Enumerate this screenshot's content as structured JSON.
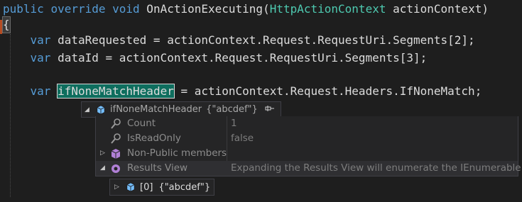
{
  "code": {
    "l1": {
      "kw1": "public",
      "kw2": "override",
      "kw3": "void",
      "method": " OnActionExecuting(",
      "type": "HttpActionContext",
      "rest": " actionContext)"
    },
    "l2": {
      "brace": "{"
    },
    "l3": {
      "kw": "var",
      "rest": " dataRequested = actionContext.Request.RequestUri.Segments[2];"
    },
    "l4": {
      "kw": "var",
      "rest": " dataId = actionContext.Request.RequestUri.Segments[3];"
    },
    "l5": {
      "kw": "var",
      "selected": "ifNoneMatchHeader",
      "rest": " = actionContext.Request.Headers.IfNoneMatch;"
    }
  },
  "datatip": {
    "name": "ifNoneMatchHeader",
    "value": "{\"abcdef\"}",
    "rows": [
      {
        "name": "Count",
        "value": "1"
      },
      {
        "name": "IsReadOnly",
        "value": "false"
      },
      {
        "name": "Non-Public members",
        "value": ""
      },
      {
        "name": "Results View",
        "value": "Expanding the Results View will enumerate the IEnumerable"
      }
    ],
    "child": {
      "index": "[0]",
      "value": "{\"abcdef\"}"
    }
  },
  "icons": {
    "object": "object-icon",
    "property": "property-wrench-icon",
    "non_public": "non-public-members-icon",
    "results": "results-view-icon",
    "pin": "pin-icon"
  },
  "colors": {
    "background": "#1e1e1e",
    "keyword": "#569cd6",
    "type": "#4ec9b0",
    "selection": "#0e6e5e"
  }
}
